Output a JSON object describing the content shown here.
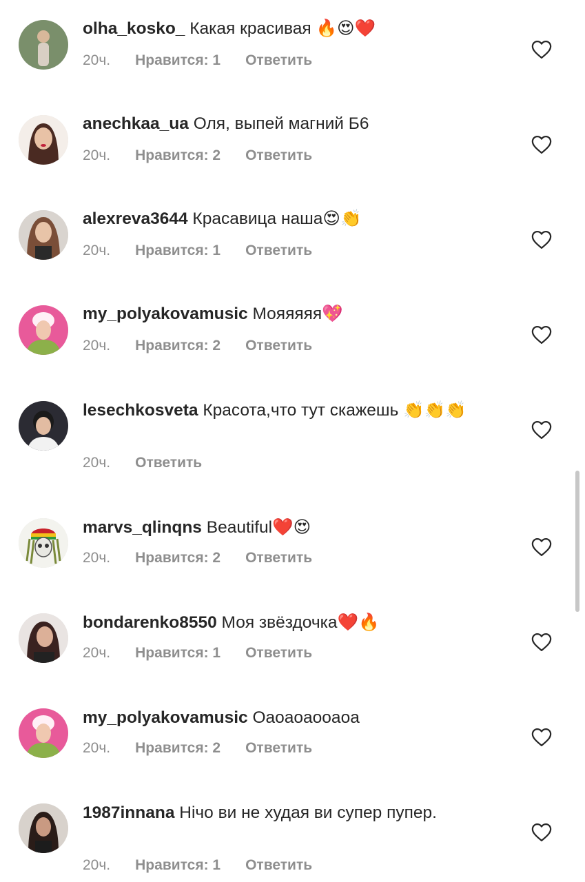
{
  "comments": [
    {
      "username": "olha_kosko_",
      "text": "Какая красивая 🔥😍❤️",
      "time": "20ч.",
      "likes": "Нравится: 1",
      "reply": "Ответить",
      "avatar_color": "#7a8f6b"
    },
    {
      "username": "anechkaa_ua",
      "text": "Оля, выпей магний Б6",
      "time": "20ч.",
      "likes": "Нравится: 2",
      "reply": "Ответить",
      "avatar_color": "#c9a48a"
    },
    {
      "username": "alexreva3644",
      "text": "Красавица наша😍👏",
      "time": "20ч.",
      "likes": "Нравится: 1",
      "reply": "Ответить",
      "avatar_color": "#8a6a55"
    },
    {
      "username": "my_polyakovamusic",
      "text": "Мояяяяя💖",
      "time": "20ч.",
      "likes": "Нравится: 2",
      "reply": "Ответить",
      "avatar_color": "#e85a9a"
    },
    {
      "username": "lesechkosveta",
      "text": "Красота,что тут скажешь 👏👏👏",
      "time": "20ч.",
      "likes": "",
      "reply": "Ответить",
      "avatar_color": "#2b2b33"
    },
    {
      "username": "marvs_qlinqns",
      "text": "Beautiful❤️😍",
      "time": "20ч.",
      "likes": "Нравится: 2",
      "reply": "Ответить",
      "avatar_color": "#c7d8b0"
    },
    {
      "username": "bondarenko8550",
      "text": "Моя звёздочка❤️🔥",
      "time": "20ч.",
      "likes": "Нравится: 1",
      "reply": "Ответить",
      "avatar_color": "#5a3a35"
    },
    {
      "username": "my_polyakovamusic",
      "text": "Оаоаоаооаоа",
      "time": "20ч.",
      "likes": "Нравится: 2",
      "reply": "Ответить",
      "avatar_color": "#e85a9a"
    },
    {
      "username": "1987innana",
      "text": "Нічо ви не худая ви супер пупер.",
      "time": "20ч.",
      "likes": "Нравится: 1",
      "reply": "Ответить",
      "avatar_color": "#6a5a55"
    }
  ],
  "icons": {
    "like": "heart-outline-icon"
  },
  "colors": {
    "meta_gray": "#8e8e8e",
    "text": "#262626"
  }
}
